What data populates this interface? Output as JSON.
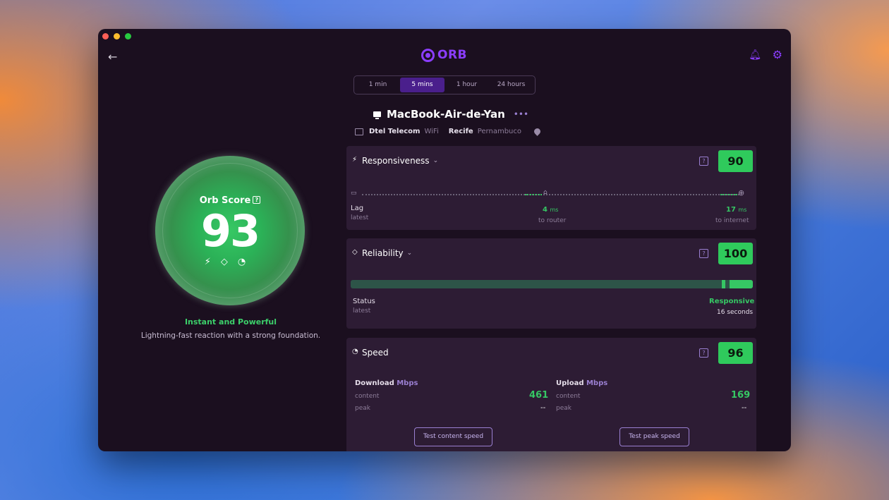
{
  "header": {
    "logo_text": "ORB",
    "icons": [
      "back-arrow-icon",
      "bell-icon",
      "gear-icon"
    ]
  },
  "time_tabs": [
    {
      "label": "1 min",
      "active": false
    },
    {
      "label": "5 mins",
      "active": true
    },
    {
      "label": "1 hour",
      "active": false
    },
    {
      "label": "24 hours",
      "active": false
    }
  ],
  "device": {
    "name": "MacBook-Air-de-Yan",
    "isp": "Dtel Telecom",
    "connection": "WiFi",
    "city": "Recife",
    "state": "Pernambuco"
  },
  "orb": {
    "label": "Orb Score",
    "help": "?",
    "score": "93",
    "tagline": "Instant and Powerful",
    "description": "Lightning-fast reaction with a strong foundation."
  },
  "responsiveness": {
    "title": "Responsiveness",
    "help": "?",
    "score": "90",
    "lag_label": "Lag",
    "lag_sub": "latest",
    "router_value": "4",
    "router_unit": "ms",
    "router_sub": "to router",
    "internet_value": "17",
    "internet_unit": "ms",
    "internet_sub": "to internet"
  },
  "reliability": {
    "title": "Reliability",
    "help": "?",
    "score": "100",
    "status_label": "Status",
    "status_sub": "latest",
    "status_value": "Responsive",
    "status_time": "16 seconds"
  },
  "speed": {
    "title": "Speed",
    "help": "?",
    "score": "96",
    "download_label": "Download",
    "upload_label": "Upload",
    "unit": "Mbps",
    "content_label": "content",
    "peak_label": "peak",
    "download_content": "461",
    "download_peak": "--",
    "upload_content": "169",
    "upload_peak": "--",
    "test_content_button": "Test content speed",
    "test_peak_button": "Test peak speed"
  },
  "colors": {
    "accent": "#8b3dff",
    "good": "#2fca5c",
    "bg": "#1b0f1f",
    "card": "#2d1c34"
  }
}
